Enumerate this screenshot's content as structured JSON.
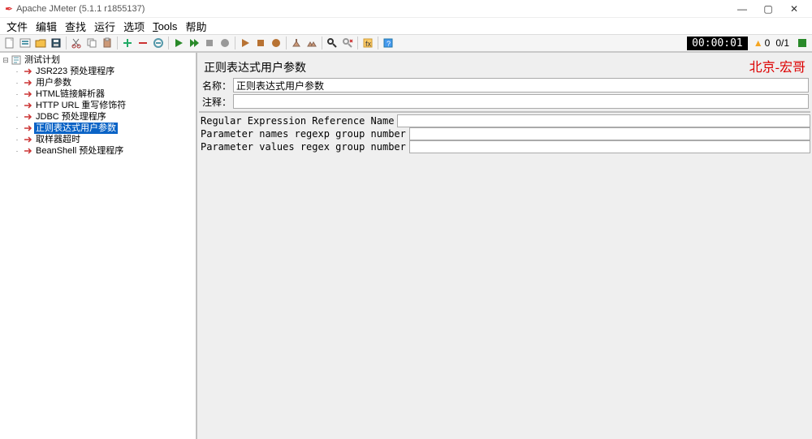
{
  "window": {
    "title": "Apache JMeter (5.1.1 r1855137)"
  },
  "menu": {
    "file": "文件",
    "edit": "编辑",
    "find": "查找",
    "run": "运行",
    "options": "选项",
    "tools_prefix": "T",
    "tools_rest": "ools",
    "help": "帮助"
  },
  "status": {
    "timer": "00:00:01",
    "warn_count": "0",
    "thread_ratio": "0/1"
  },
  "tree": {
    "root": "测试计划",
    "children": [
      "JSR223 预处理程序",
      "用户参数",
      "HTML链接解析器",
      "HTTP URL 重写修饰符",
      "JDBC 预处理程序",
      "正则表达式用户参数",
      "取样器超时",
      "BeanShell 预处理程序"
    ],
    "selected_index": 5
  },
  "detail": {
    "title": "正则表达式用户参数",
    "watermark": "北京-宏哥",
    "name_label": "名称：",
    "name_value": "正则表达式用户参数",
    "comment_label": "注释：",
    "comment_value": "",
    "fields": [
      {
        "label": "Regular Expression Reference Name",
        "value": ""
      },
      {
        "label": "Parameter names regexp group number",
        "value": ""
      },
      {
        "label": "Parameter values regex group number",
        "value": ""
      }
    ]
  }
}
